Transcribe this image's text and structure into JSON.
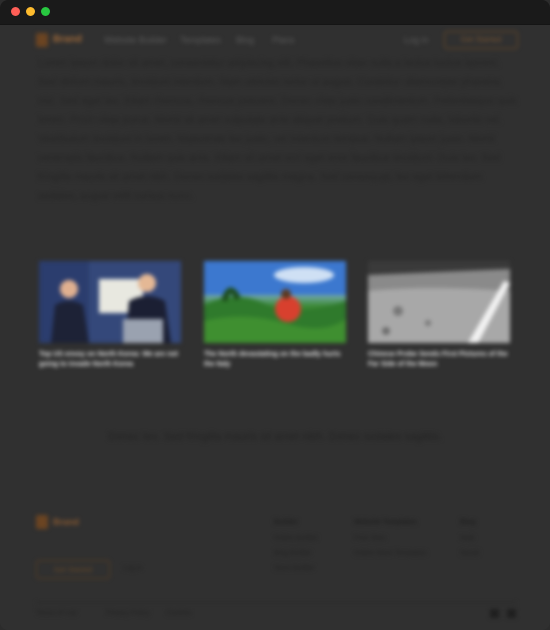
{
  "nav": {
    "brand": "Brand",
    "links": [
      "Website Builder",
      "Templates",
      "Blog",
      "Plans"
    ],
    "login": "Log in",
    "cta": "Get Started"
  },
  "article": {
    "paragraph": "Lorem ipsum dolor sit amet, consectetur adipiscing elit. Phasellus vitae nulla a lectus luctus laoreet. Sed dictum mauris, tincidunt interdum. Nam ultricies tortor ut augue. Curabitur ullamcorper pharetra nisl. Sed eget leo. Etiam rhoncus, rhoncus posuere. Donec vitae justo condimentum. Pellentesque quis lorem. Proin vitae purus. Morbi sit amet vulputate ante aliquet pretium. Duis quam nulla, lobortis vel. Vestibulum tincidunt in lorem. Maecenas leo justo, vel interdum tempus. Nullam ipsum justo. Morbi venenatis faucibus. Nullam quis ante. Etiam sit amet orci eget eros faucibus tincidunt. Duis leo. Sed fringilla mauris sit amet nibh. Donec sodales sagittis magna. Sed consequat, leo eget bibendum sodales, augue velit cursus nunc."
  },
  "cards": [
    {
      "caption": "Top US envoy on North Korea: We are not going to invade North Korea",
      "image": "press-conference-photo"
    },
    {
      "caption": "The North devastating on the badly hurts the Italy",
      "image": "tropical-nature-photo"
    },
    {
      "caption": "Chinese Probe Sends First Pictures of the Far Side of the Moon",
      "image": "lunar-surface-photo"
    }
  ],
  "quote": "Donec leo. Sed fringilla mauris sit amet nibh. Donec sodales sagittis.",
  "footer": {
    "brand": "Brand",
    "cta": "Get Started",
    "login": "Log in",
    "col1_head": "Builder",
    "col1_links": [
      "Online Builder",
      "Blog Builder",
      "Store Builder"
    ],
    "col2_head": "Website Templates",
    "col2_links": [
      "Free Sites",
      "Online Store Templates"
    ],
    "col3_head": "Blog",
    "col3_links": [
      "Help",
      "Social"
    ],
    "bottom_links": [
      "Terms of Use",
      "Privacy Policy",
      "Cookies"
    ]
  },
  "colors": {
    "accent": "#a06a3a",
    "window_bg": "#303030",
    "titlebar_bg": "#1a1a1a"
  }
}
